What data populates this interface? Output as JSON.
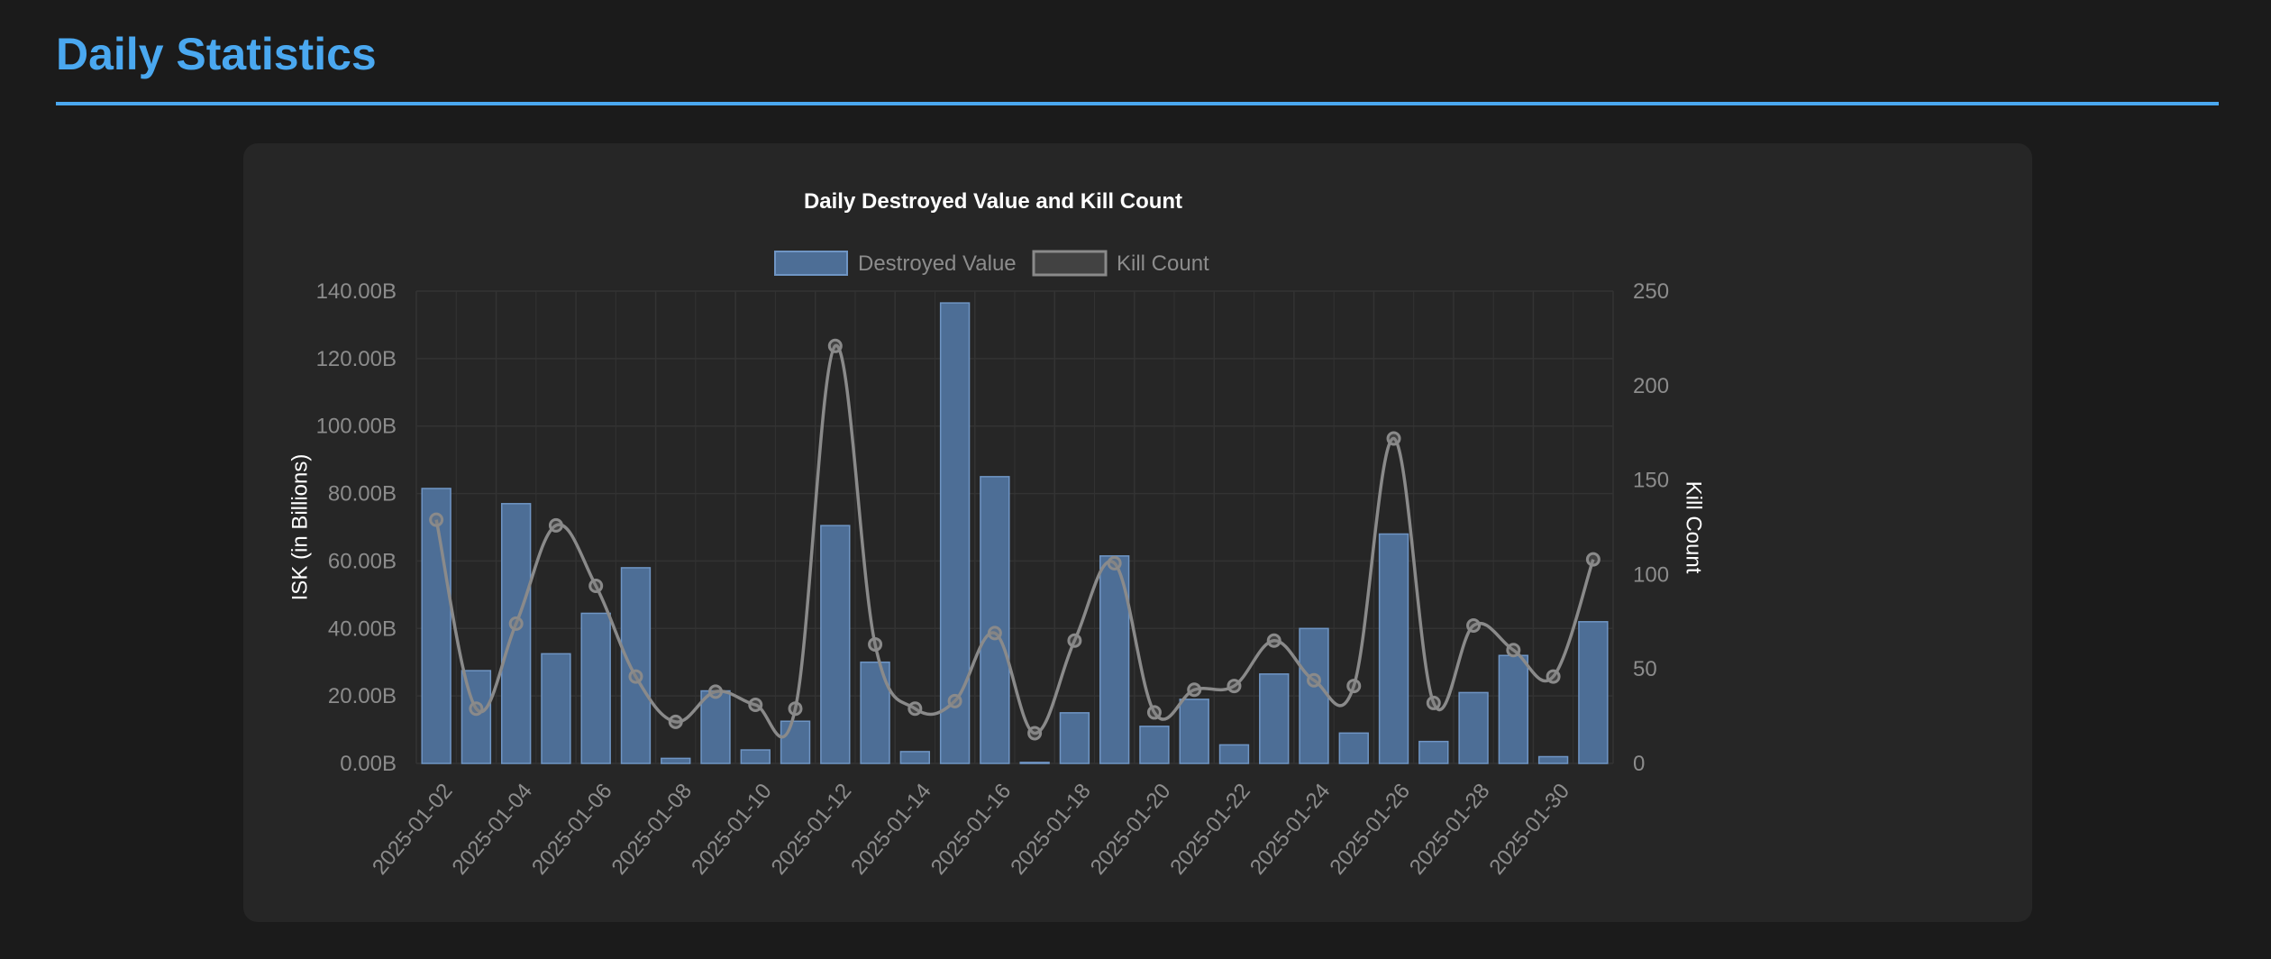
{
  "page": {
    "title": "Daily Statistics"
  },
  "colors": {
    "accent": "#4aa8f0",
    "background": "#1b1b1b",
    "card": "#262626",
    "bar_fill": "#4d6e96",
    "bar_stroke": "#6f95c4",
    "line": "#8a8a8a",
    "grid": "#333333",
    "tick_text": "#8c8c8c",
    "title_text": "#ffffff"
  },
  "chart_data": {
    "type": "bar",
    "title": "Daily Destroyed Value and Kill Count",
    "legend": {
      "position": "top",
      "entries": [
        "Destroyed Value",
        "Kill Count"
      ]
    },
    "grid": true,
    "categories": [
      "2025-01-02",
      "2025-01-03",
      "2025-01-04",
      "2025-01-05",
      "2025-01-06",
      "2025-01-07",
      "2025-01-08",
      "2025-01-09",
      "2025-01-10",
      "2025-01-11",
      "2025-01-12",
      "2025-01-13",
      "2025-01-14",
      "2025-01-15",
      "2025-01-16",
      "2025-01-17",
      "2025-01-18",
      "2025-01-19",
      "2025-01-20",
      "2025-01-21",
      "2025-01-22",
      "2025-01-23",
      "2025-01-24",
      "2025-01-25",
      "2025-01-26",
      "2025-01-27",
      "2025-01-28",
      "2025-01-29",
      "2025-01-30",
      "2025-01-31"
    ],
    "x_tick_labels": [
      "2025-01-02",
      "2025-01-04",
      "2025-01-06",
      "2025-01-08",
      "2025-01-10",
      "2025-01-12",
      "2025-01-14",
      "2025-01-16",
      "2025-01-18",
      "2025-01-20",
      "2025-01-22",
      "2025-01-24",
      "2025-01-26",
      "2025-01-28",
      "2025-01-30"
    ],
    "y_left": {
      "label": "ISK (in Billions)",
      "range": [
        0,
        140
      ],
      "ticks": [
        "0.00B",
        "20.00B",
        "40.00B",
        "60.00B",
        "80.00B",
        "100.00B",
        "120.00B",
        "140.00B"
      ]
    },
    "y_right": {
      "label": "Kill Count",
      "range": [
        0,
        250
      ],
      "ticks": [
        "0",
        "50",
        "100",
        "150",
        "200",
        "250"
      ]
    },
    "series": [
      {
        "name": "Destroyed Value",
        "type": "bar",
        "axis": "left",
        "values": [
          81.5,
          27.5,
          77,
          32.5,
          44.5,
          58,
          1.5,
          21.5,
          4,
          12.5,
          70.5,
          30,
          3.5,
          136.5,
          85,
          0.3,
          15,
          61.5,
          11,
          19,
          5.5,
          26.5,
          40,
          9,
          68,
          6.5,
          21,
          32,
          2,
          42
        ]
      },
      {
        "name": "Kill Count",
        "type": "line",
        "axis": "right",
        "values": [
          129,
          29,
          74,
          126,
          94,
          46,
          22,
          38,
          31,
          29,
          221,
          63,
          29,
          33,
          69,
          16,
          65,
          106,
          27,
          39,
          41,
          65,
          44,
          41,
          172,
          32,
          73,
          60,
          46,
          108
        ]
      }
    ]
  }
}
